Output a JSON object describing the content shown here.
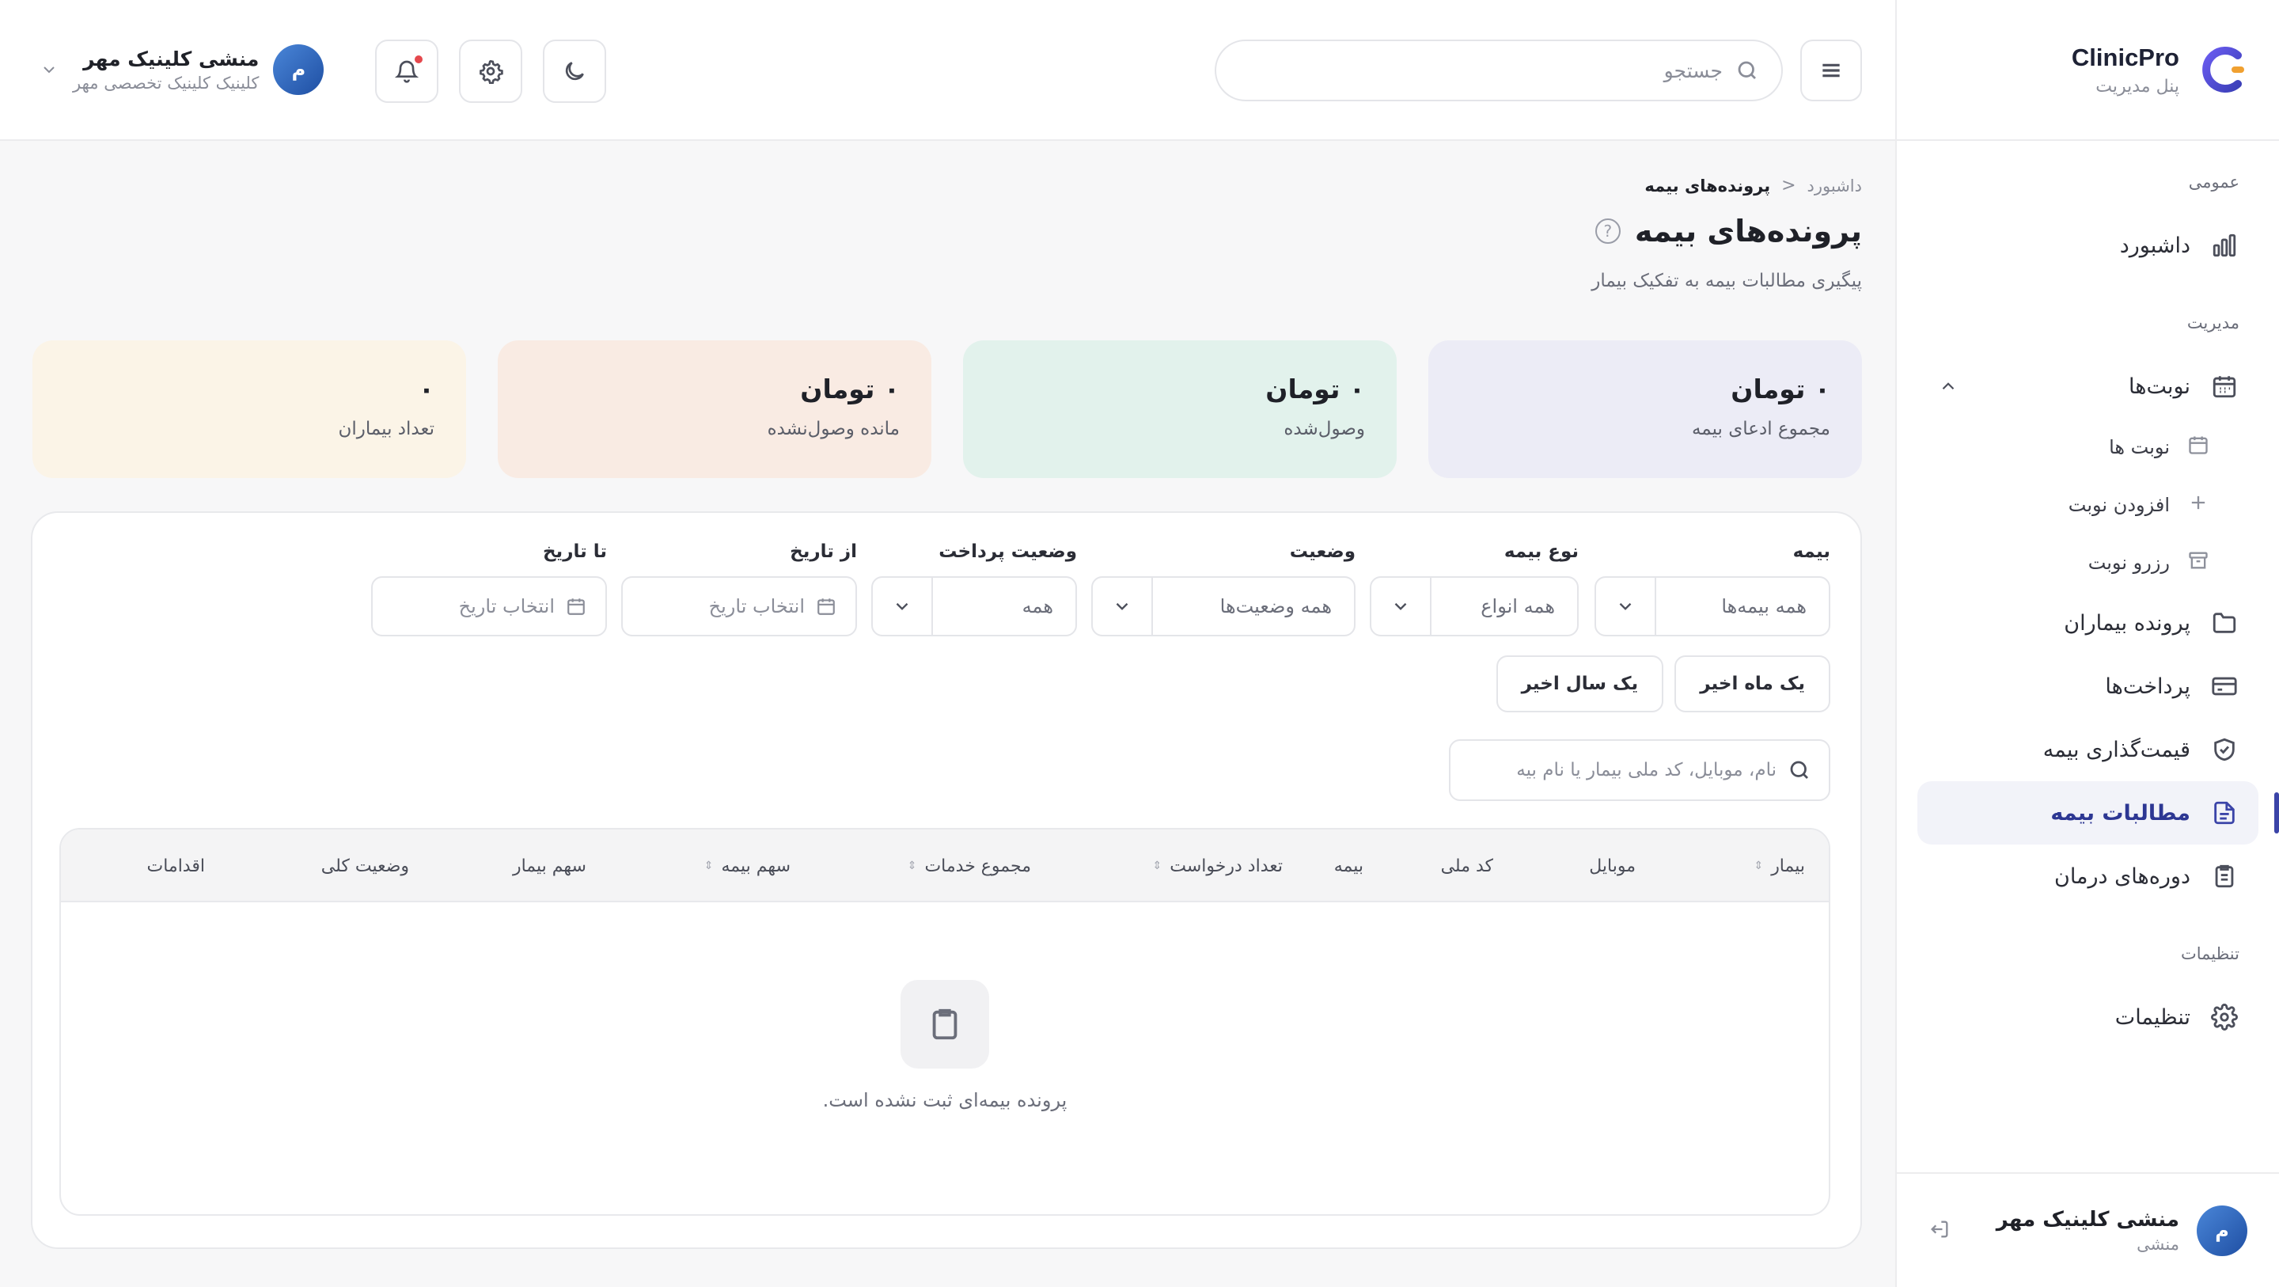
{
  "brand": {
    "name": "ClinicPro",
    "subtitle": "پنل مدیریت"
  },
  "sidebar": {
    "sections": [
      {
        "title": "عمومی"
      },
      {
        "title": "مدیریت"
      },
      {
        "title": "تنظیمات"
      }
    ],
    "items": {
      "dashboard": "داشبورد",
      "appointments": "نوبت‌ها",
      "appointments_list": "نوبت ها",
      "add_appointment": "افزودن نوبت",
      "reserve_appointment": "رزرو نوبت",
      "patient_records": "پرونده بیماران",
      "payments": "پرداخت‌ها",
      "insurance_pricing": "قیمت‌گذاری بیمه",
      "insurance_claims": "مطالبات بیمه",
      "treatment_courses": "دوره‌های درمان",
      "settings": "تنظیمات"
    },
    "user": {
      "avatar": "م",
      "name": "منشی کلینیک مهر",
      "role": "منشی"
    }
  },
  "topbar": {
    "search_placeholder": "جستجو",
    "user": {
      "avatar": "م",
      "name": "منشی کلینیک مهر",
      "clinic": "کلینیک کلینیک تخصصی مهر"
    }
  },
  "breadcrumb": {
    "home": "داشبورد",
    "separator": "<",
    "current": "پرونده‌های بیمه"
  },
  "page": {
    "title": "پرونده‌های بیمه",
    "subtitle": "پیگیری مطالبات بیمه به تفکیک بیمار"
  },
  "stats": [
    {
      "value": "۰ تومان",
      "label": "مجموع ادعای بیمه",
      "color": "#ececf6"
    },
    {
      "value": "۰ تومان",
      "label": "وصول‌شده",
      "color": "#e2f2ec"
    },
    {
      "value": "۰ تومان",
      "label": "مانده وصول‌نشده",
      "color": "#f9ebe3"
    },
    {
      "value": "۰",
      "label": "تعداد بیماران",
      "color": "#fbf4e7"
    }
  ],
  "filters": {
    "insurance": {
      "label": "بیمه",
      "value": "همه بیمه‌ها"
    },
    "insurance_type": {
      "label": "نوع بیمه",
      "value": "همه انواع"
    },
    "status": {
      "label": "وضعیت",
      "value": "همه وضعیت‌ها"
    },
    "payment_status": {
      "label": "وضعیت پرداخت",
      "value": "همه"
    },
    "from_date": {
      "label": "از تاریخ",
      "placeholder": "انتخاب تاریخ"
    },
    "to_date": {
      "label": "تا تاریخ",
      "placeholder": "انتخاب تاریخ"
    }
  },
  "quick_ranges": {
    "last_month": "یک ماه اخیر",
    "last_year": "یک سال اخیر"
  },
  "table_search_placeholder": "نام، موبایل، کد ملی بیمار یا نام بیه",
  "table": {
    "columns": {
      "patient": "بیمار",
      "mobile": "موبایل",
      "national_id": "کد ملی",
      "insurance": "بیمه",
      "request_count": "تعداد درخواست",
      "services_total": "مجموع خدمات",
      "insurance_share": "سهم بیمه",
      "patient_share": "سهم بیمار",
      "overall_status": "وضعیت کلی",
      "actions": "اقدامات"
    },
    "empty_text": "پرونده بیمه‌ای ثبت نشده است."
  }
}
